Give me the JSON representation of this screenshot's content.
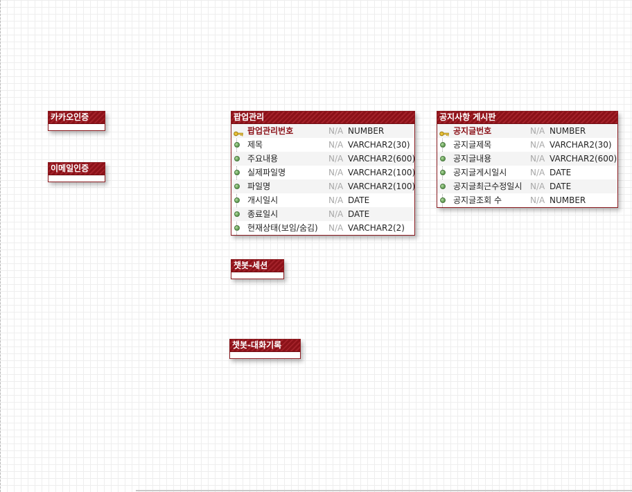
{
  "colors": {
    "header": "#8b1118",
    "pk_text": "#8b1118",
    "nullable": "#a8a8a8",
    "dot": "#6aa35a"
  },
  "entities": {
    "kakao": {
      "title": "카카오인증",
      "columns": []
    },
    "email": {
      "title": "이메일인증",
      "columns": []
    },
    "popup": {
      "title": "팝업관리",
      "columns": [
        {
          "name": "팝업관리번호",
          "nullable": "N/A",
          "type": "NUMBER",
          "icon": "key-icon",
          "pk": true
        },
        {
          "name": "제목",
          "nullable": "N/A",
          "type": "VARCHAR2(30)",
          "icon": "column-dot-icon"
        },
        {
          "name": "주요내용",
          "nullable": "N/A",
          "type": "VARCHAR2(600)",
          "icon": "column-dot-icon"
        },
        {
          "name": "실제파일명",
          "nullable": "N/A",
          "type": "VARCHAR2(100)",
          "icon": "column-dot-icon"
        },
        {
          "name": "파일명",
          "nullable": "N/A",
          "type": "VARCHAR2(100)",
          "icon": "column-dot-icon"
        },
        {
          "name": "개시일시",
          "nullable": "N/A",
          "type": "DATE",
          "icon": "column-dot-icon"
        },
        {
          "name": "종료일시",
          "nullable": "N/A",
          "type": "DATE",
          "icon": "column-dot-icon"
        },
        {
          "name": "현재상태(보임/숨김)",
          "nullable": "N/A",
          "type": "VARCHAR2(2)",
          "icon": "column-dot-icon"
        }
      ]
    },
    "notice": {
      "title": "공지사항 게시판",
      "columns": [
        {
          "name": "공지글번호",
          "nullable": "N/A",
          "type": "NUMBER",
          "icon": "key-icon",
          "pk": true
        },
        {
          "name": "공지글제목",
          "nullable": "N/A",
          "type": "VARCHAR2(30)",
          "icon": "column-dot-icon"
        },
        {
          "name": "공지글내용",
          "nullable": "N/A",
          "type": "VARCHAR2(600)",
          "icon": "column-dot-icon"
        },
        {
          "name": "공지글게시일시",
          "nullable": "N/A",
          "type": "DATE",
          "icon": "column-dot-icon"
        },
        {
          "name": "공지글최근수정일시",
          "nullable": "N/A",
          "type": "DATE",
          "icon": "column-dot-icon"
        },
        {
          "name": "공지글조회 수",
          "nullable": "N/A",
          "type": "NUMBER",
          "icon": "column-dot-icon"
        }
      ]
    },
    "chatbot_session": {
      "title": "챗봇-세션",
      "columns": []
    },
    "chatbot_history": {
      "title": "챗봇-대화기록",
      "columns": []
    }
  }
}
